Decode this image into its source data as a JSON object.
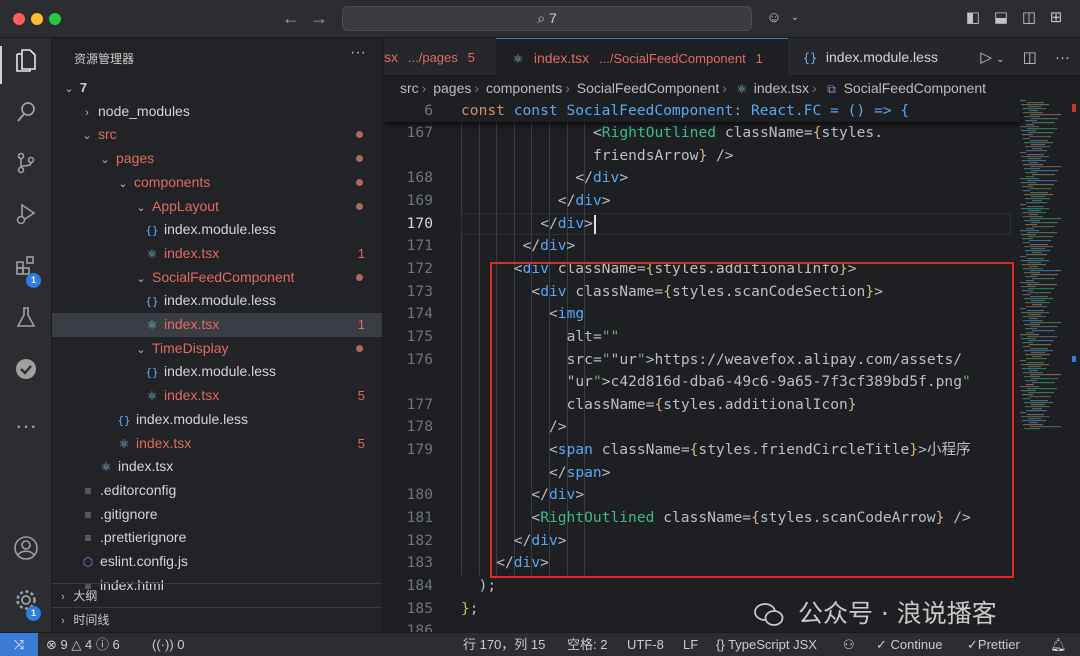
{
  "window": {
    "search_text": "7"
  },
  "colors": {
    "accent": "#3a7bd5",
    "git_modified": "#e26a5f",
    "highlight_box": "#e02b2b"
  },
  "activity_bar": {
    "extensions_badge": "1",
    "accounts_badge": "1",
    "icons": [
      "files-icon",
      "search-icon",
      "source-control-icon",
      "run-debug-icon",
      "extensions-icon",
      "testing-icon",
      "tasks-icon",
      "more-icon",
      "account-icon",
      "settings-icon"
    ]
  },
  "sidebar": {
    "title": "资源管理器",
    "root": "7",
    "tree": [
      {
        "label": "node_modules",
        "kind": "folder",
        "open": false,
        "depth": 1,
        "git": false
      },
      {
        "label": "src",
        "kind": "folder",
        "open": true,
        "depth": 1,
        "git": true,
        "dot": true
      },
      {
        "label": "pages",
        "kind": "folder",
        "open": true,
        "depth": 2,
        "git": true,
        "dot": true
      },
      {
        "label": "components",
        "kind": "folder",
        "open": true,
        "depth": 3,
        "git": true,
        "dot": true
      },
      {
        "label": "AppLayout",
        "kind": "folder",
        "open": true,
        "depth": 4,
        "git": true,
        "dot": true
      },
      {
        "label": "index.module.less",
        "kind": "less",
        "depth": 5,
        "git": false
      },
      {
        "label": "index.tsx",
        "kind": "react",
        "depth": 5,
        "git": true,
        "count": "1"
      },
      {
        "label": "SocialFeedComponent",
        "kind": "folder",
        "open": true,
        "depth": 4,
        "git": true,
        "dot": true
      },
      {
        "label": "index.module.less",
        "kind": "less",
        "depth": 5,
        "git": false
      },
      {
        "label": "index.tsx",
        "kind": "react",
        "depth": 5,
        "git": true,
        "count": "1",
        "selected": true
      },
      {
        "label": "TimeDisplay",
        "kind": "folder",
        "open": true,
        "depth": 4,
        "git": true,
        "dot": true
      },
      {
        "label": "index.module.less",
        "kind": "less",
        "depth": 5,
        "git": false
      },
      {
        "label": "index.tsx",
        "kind": "react",
        "depth": 5,
        "git": true,
        "count": "5"
      },
      {
        "label": "index.module.less",
        "kind": "less",
        "depth": 3,
        "git": false
      },
      {
        "label": "index.tsx",
        "kind": "react",
        "depth": 3,
        "git": true,
        "count": "5"
      },
      {
        "label": "index.tsx",
        "kind": "react",
        "depth": 2,
        "git": false
      },
      {
        "label": ".editorconfig",
        "kind": "config",
        "depth": 1,
        "git": false
      },
      {
        "label": ".gitignore",
        "kind": "config",
        "depth": 1,
        "git": false
      },
      {
        "label": ".prettierignore",
        "kind": "config",
        "depth": 1,
        "git": false
      },
      {
        "label": "eslint.config.js",
        "kind": "eslint",
        "depth": 1,
        "git": false
      },
      {
        "label": "index.html",
        "kind": "config",
        "depth": 1,
        "git": false
      }
    ],
    "outline_label": "大纲",
    "timeline_label": "时间线"
  },
  "tabs": [
    {
      "label": "sx",
      "path": ".../pages",
      "count": "5",
      "active": false
    },
    {
      "label": "index.tsx",
      "path": ".../SocialFeedComponent",
      "count": "1",
      "active": true
    },
    {
      "label": "index.module.less",
      "path": "",
      "count": "",
      "active": false
    }
  ],
  "breadcrumb": [
    "src",
    "pages",
    "components",
    "SocialFeedComponent",
    "index.tsx",
    "SocialFeedComponent"
  ],
  "editor": {
    "sticky": {
      "line": "6",
      "text": "const SocialFeedComponent: React.FC = () => {"
    },
    "current_line": "170",
    "lines": [
      {
        "n": "167",
        "text": "<RightOutlined className={styles."
      },
      {
        "n": "",
        "text": "friendsArrow} />"
      },
      {
        "n": "168",
        "text": "</div>"
      },
      {
        "n": "169",
        "text": "</div>"
      },
      {
        "n": "170",
        "text": "</div>"
      },
      {
        "n": "171",
        "text": "</div>"
      },
      {
        "n": "172",
        "text": "<div className={styles.additionalInfo}>"
      },
      {
        "n": "173",
        "text": "<div className={styles.scanCodeSection}>"
      },
      {
        "n": "174",
        "text": "<img"
      },
      {
        "n": "175",
        "text": "alt=\"\""
      },
      {
        "n": "176",
        "text": "src=\"https://weavefox.alipay.com/assets/"
      },
      {
        "n": "",
        "text": "c42d816d-dba6-49c6-9a65-7f3cf389bd5f.png\""
      },
      {
        "n": "177",
        "text": "className={styles.additionalIcon}"
      },
      {
        "n": "178",
        "text": "/>"
      },
      {
        "n": "179",
        "text": "<span className={styles.friendCircleTitle}>小程序"
      },
      {
        "n": "",
        "text": "</span>"
      },
      {
        "n": "180",
        "text": "</div>"
      },
      {
        "n": "181",
        "text": "<RightOutlined className={styles.scanCodeArrow} />"
      },
      {
        "n": "182",
        "text": "</div>"
      },
      {
        "n": "183",
        "text": "</div>"
      },
      {
        "n": "184",
        "text": ");"
      },
      {
        "n": "185",
        "text": "};"
      },
      {
        "n": "186",
        "text": ""
      }
    ]
  },
  "watermark": "公众号 · 浪说播客",
  "statusbar": {
    "errors": "9",
    "warnings": "4",
    "infos": "6",
    "ports": "0",
    "position": "行 170，列 15",
    "indent": "空格: 2",
    "encoding": "UTF-8",
    "eol": "LF",
    "language": "TypeScript JSX",
    "continue": "Continue",
    "prettier": "Prettier"
  }
}
